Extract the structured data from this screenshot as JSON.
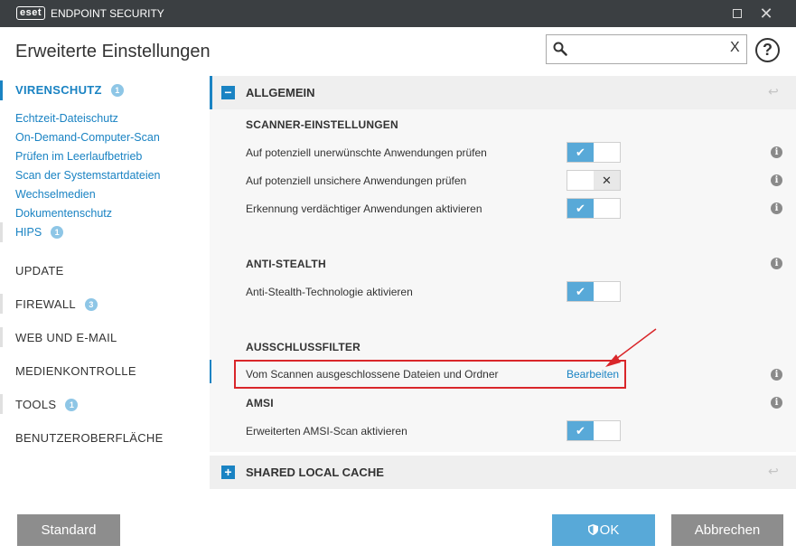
{
  "window": {
    "logo": "eset",
    "app_title": "ENDPOINT SECURITY",
    "maximize_icon": "maximize-icon",
    "close_glyph": "✕"
  },
  "header": {
    "title": "Erweiterte Einstellungen",
    "search_value": "",
    "search_clear": "X",
    "help": "?"
  },
  "sidebar": {
    "sections": [
      {
        "label": "VIRENSCHUTZ",
        "badge": "1",
        "active": true
      },
      {
        "label": "UPDATE",
        "badge": null
      },
      {
        "label": "FIREWALL",
        "badge": "3"
      },
      {
        "label": "WEB UND E-MAIL",
        "badge": null
      },
      {
        "label": "MEDIENKONTROLLE",
        "badge": null
      },
      {
        "label": "TOOLS",
        "badge": "1"
      },
      {
        "label": "BENUTZEROBERFLÄCHE",
        "badge": null
      }
    ],
    "virenschutz_items": [
      {
        "label": "Echtzeit-Dateischutz"
      },
      {
        "label": "On-Demand-Computer-Scan"
      },
      {
        "label": "Prüfen im Leerlaufbetrieb"
      },
      {
        "label": "Scan der Systemstartdateien"
      },
      {
        "label": "Wechselmedien"
      },
      {
        "label": "Dokumentenschutz"
      },
      {
        "label": "HIPS",
        "badge": "1"
      }
    ]
  },
  "main": {
    "allgemein": {
      "toggle": "−",
      "title": "ALLGEMEIN",
      "revert_icon": "↩"
    },
    "scanner": {
      "heading": "SCANNER-EINSTELLUNGEN",
      "rows": [
        {
          "label": "Auf potenziell unerwünschte Anwendungen prüfen",
          "enabled": true
        },
        {
          "label": "Auf potenziell unsichere Anwendungen prüfen",
          "enabled": false
        },
        {
          "label": "Erkennung verdächtiger Anwendungen aktivieren",
          "enabled": true
        }
      ]
    },
    "anti_stealth": {
      "heading": "ANTI-STEALTH",
      "rows": [
        {
          "label": "Anti-Stealth-Technologie aktivieren",
          "enabled": true
        }
      ]
    },
    "ausschlussfilter": {
      "heading": "AUSSCHLUSSFILTER",
      "row_label": "Vom Scannen ausgeschlossene Dateien und Ordner",
      "link": "Bearbeiten"
    },
    "amsi": {
      "heading": "AMSI",
      "rows": [
        {
          "label": "Erweiterten AMSI-Scan aktivieren",
          "enabled": true
        }
      ]
    },
    "shared_cache": {
      "toggle": "+",
      "title": "SHARED LOCAL CACHE",
      "revert_icon": "↩"
    },
    "info_glyph": "i",
    "check_glyph": "✔",
    "cross_glyph": "✕"
  },
  "footer": {
    "standard": "Standard",
    "ok": "OK",
    "cancel": "Abbrechen"
  },
  "colors": {
    "accent": "#1a83c3",
    "switch_on": "#58a9d8",
    "annotation": "#d9262a",
    "titlebar": "#3b3f42"
  }
}
